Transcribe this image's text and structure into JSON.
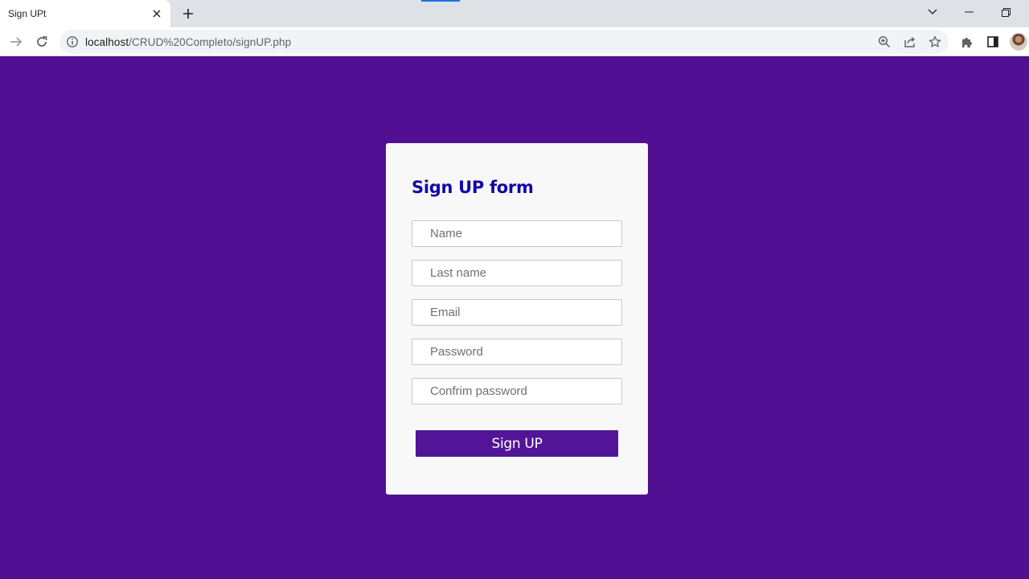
{
  "browser": {
    "tab_title": "Sign UPt",
    "url_host": "localhost",
    "url_path": "/CRUD%20Completo/signUP.php"
  },
  "icons": {
    "back": "arrow-right-icon",
    "reload": "reload-icon",
    "info": "info-icon",
    "zoom": "zoom-icon",
    "share": "share-icon",
    "bookmark": "star-icon",
    "extensions": "puzzle-icon",
    "sidepanel": "side-panel-icon"
  },
  "form": {
    "title": "Sign UP form",
    "fields": {
      "name": {
        "placeholder": "Name",
        "value": ""
      },
      "last_name": {
        "placeholder": "Last name",
        "value": ""
      },
      "email": {
        "placeholder": "Email",
        "value": ""
      },
      "password": {
        "placeholder": "Password",
        "value": ""
      },
      "confirm_password": {
        "placeholder": "Confrim password",
        "value": ""
      }
    },
    "submit_label": "Sign UP"
  },
  "colors": {
    "page_background": "#511093",
    "card_background": "#f8f8f8",
    "title_color": "#1307a7",
    "button_background": "#521597",
    "button_text": "#ffffff"
  }
}
